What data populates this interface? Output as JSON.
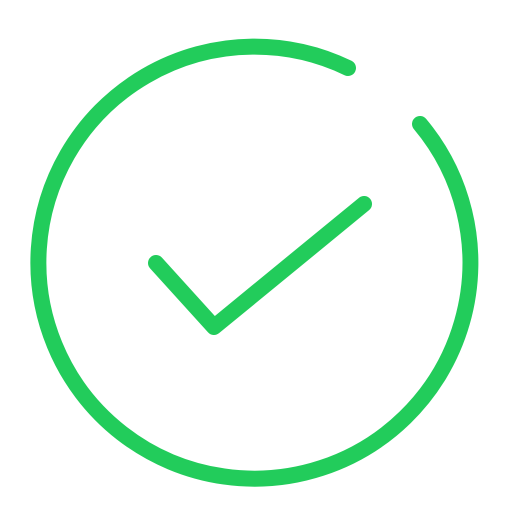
{
  "icon": {
    "name": "check-circle-icon",
    "color": "#22cc5b",
    "background": "#ffffff"
  }
}
